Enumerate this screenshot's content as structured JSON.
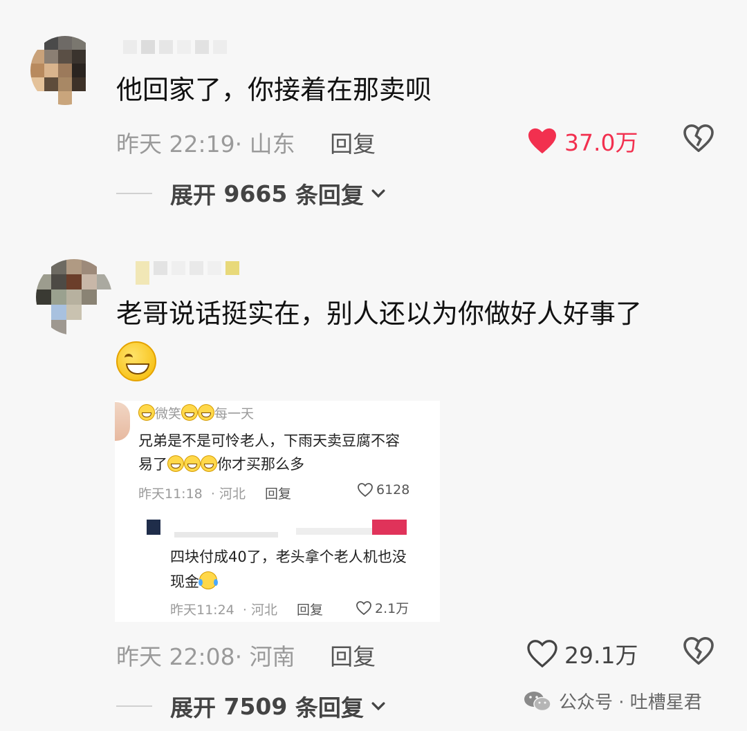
{
  "comment1": {
    "text": "他回家了，你接着在那卖呗",
    "time": "昨天 22:19",
    "location": "· 山东",
    "reply_label": "回复",
    "likes": "37.0万",
    "expand_label": "展开",
    "expand_count": "9665",
    "expand_suffix": "条回复"
  },
  "comment2": {
    "text": "老哥说话挺实在，别人还以为你做好人好事了",
    "time": "昨天 22:08",
    "location": "· 河南",
    "reply_label": "回复",
    "likes": "29.1万",
    "expand_label": "展开",
    "expand_count": "7509",
    "expand_suffix": "条回复"
  },
  "embedded": {
    "reply1": {
      "username_a": "微笑",
      "username_b": "每一天",
      "line1": "兄弟是不是可怜老人，下雨天卖豆腐不容",
      "line2a": "易了",
      "line2b": "你才买那么多",
      "time": "昨天11:18",
      "location": "· 河北",
      "reply_label": "回复",
      "likes": "6128"
    },
    "reply2": {
      "line1": "四块付成40了，老头拿个老人机也没",
      "line2": "现金",
      "time": "昨天11:24",
      "location": "· 河北",
      "reply_label": "回复",
      "likes": "2.1万"
    }
  },
  "watermark": {
    "text": "公众号 · 吐槽星君",
    "icon": "wechat-icon"
  },
  "colors": {
    "like_active": "#f2304f",
    "meta_gray": "#9a9a9a"
  }
}
